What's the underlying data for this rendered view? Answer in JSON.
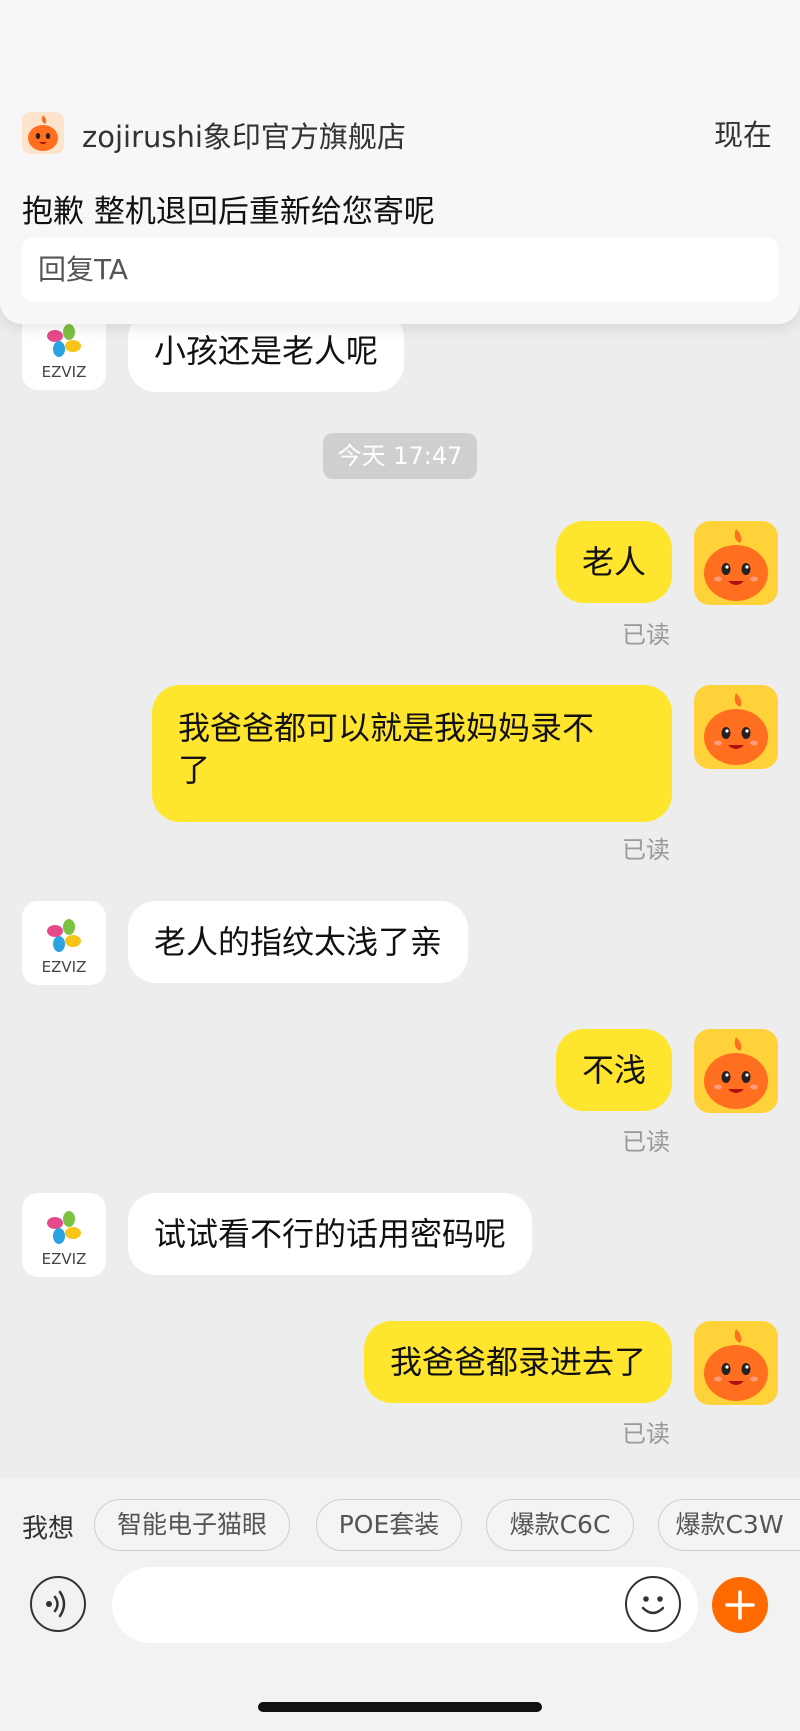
{
  "notification": {
    "shop_name": "zojirushi象印官方旗舰店",
    "time": "现在",
    "message": "抱歉 整机退回后重新给您寄呢",
    "reply_label": "回复TA"
  },
  "shop_avatar": {
    "text": "EZVIZ"
  },
  "messages": [
    {
      "side": "left",
      "text": "小孩还是老人呢"
    },
    {
      "side": "right",
      "text": "老人",
      "status": "已读"
    },
    {
      "side": "right",
      "line1": "我爸爸都可以就是我妈妈录不",
      "line2": "了",
      "status": "已读"
    },
    {
      "side": "left",
      "text": "老人的指纹太浅了亲"
    },
    {
      "side": "right",
      "text": "不浅",
      "status": "已读"
    },
    {
      "side": "left",
      "text": "试试看不行的话用密码呢"
    },
    {
      "side": "right",
      "text": "我爸爸都录进去了",
      "status": "已读"
    }
  ],
  "timestamp": "今天 17:47",
  "suggestions": {
    "label": "我想",
    "items": [
      "智能电子猫眼",
      "POE套装",
      "爆款C6C",
      "爆款C3W"
    ]
  },
  "input": {
    "placeholder": ""
  },
  "colors": {
    "my_bubble": "#ffe52d",
    "their_bubble": "#ffffff",
    "chat_bg": "#ededed",
    "plus_button": "#ff6a00",
    "my_avatar_bg": "#ffd23a"
  },
  "icons": {
    "voice": "voice-icon",
    "emoji": "emoji-icon",
    "plus": "plus-icon",
    "shop_logo": "ezviz-logo-icon",
    "user_avatar": "mascot-icon"
  }
}
